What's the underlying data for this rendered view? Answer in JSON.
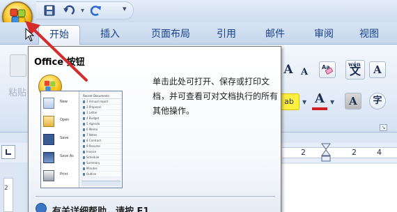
{
  "quick_access": {
    "icons": [
      "save-icon",
      "undo-icon",
      "redo-icon",
      "customize-quick-access-icon"
    ],
    "dropdown_glyph": "▾",
    "customize_glyph": "▾"
  },
  "tabs": [
    {
      "label": "开始",
      "active": true
    },
    {
      "label": "插入",
      "active": false
    },
    {
      "label": "页面布局",
      "active": false
    },
    {
      "label": "引用",
      "active": false
    },
    {
      "label": "邮件",
      "active": false
    },
    {
      "label": "审阅",
      "active": false
    },
    {
      "label": "视图",
      "active": false
    }
  ],
  "ribbon": {
    "paste_label": "粘贴",
    "grow_font": "A",
    "shrink_font": "A",
    "phonetic_top": "wén",
    "phonetic_char": "文",
    "char_border": "A",
    "highlight_label": "ab",
    "font_color": "A",
    "char_shading": "A",
    "enclose_char": "字"
  },
  "tooltip": {
    "title": "Office 按钮",
    "description": "单击此处可打开、保存或打印文档，并可查看可对文档执行的所有其他操作。",
    "help_text": "有关详细帮助，请按 F1"
  },
  "thumbnail": {
    "menu_items": [
      "New",
      "Open",
      "Save",
      "Save As",
      "Print"
    ],
    "recent_title": "Recent Documents",
    "recent_docs": [
      "1 Annual report",
      "2 Proposal",
      "3 Letter",
      "4 Budget",
      "5 Agenda",
      "6 Memo",
      "7 Notes",
      "8 Contract",
      "9 Resume",
      "Invoice",
      "Schedule",
      "Summary",
      "Minutes",
      "Outline"
    ]
  },
  "ruler": {
    "numbers": [
      "2",
      "2",
      "4"
    ],
    "vertical_number": "2"
  },
  "colors": {
    "tab_text": "#15428b",
    "ribbon_bg": "#dbe6f4",
    "orb": "#ffd447",
    "annotation_arrow": "#d42b2b",
    "font_color_bar": "#d02020"
  }
}
